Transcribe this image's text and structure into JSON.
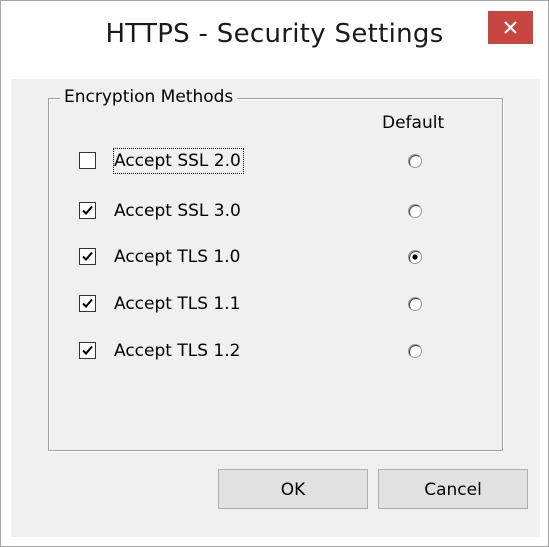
{
  "window": {
    "title": "HTTPS - Security Settings"
  },
  "close_button": {
    "icon": "close-icon",
    "color": "#c7463f"
  },
  "group": {
    "label": "Encryption Methods",
    "default_column_label": "Default",
    "items": [
      {
        "label": "Accept SSL 2.0",
        "checked": false,
        "default": false
      },
      {
        "label": "Accept SSL 3.0",
        "checked": true,
        "default": false
      },
      {
        "label": "Accept TLS 1.0",
        "checked": true,
        "default": true
      },
      {
        "label": "Accept TLS 1.1",
        "checked": true,
        "default": false
      },
      {
        "label": "Accept TLS 1.2",
        "checked": true,
        "default": false
      }
    ]
  },
  "buttons": {
    "ok_label": "OK",
    "cancel_label": "Cancel"
  }
}
